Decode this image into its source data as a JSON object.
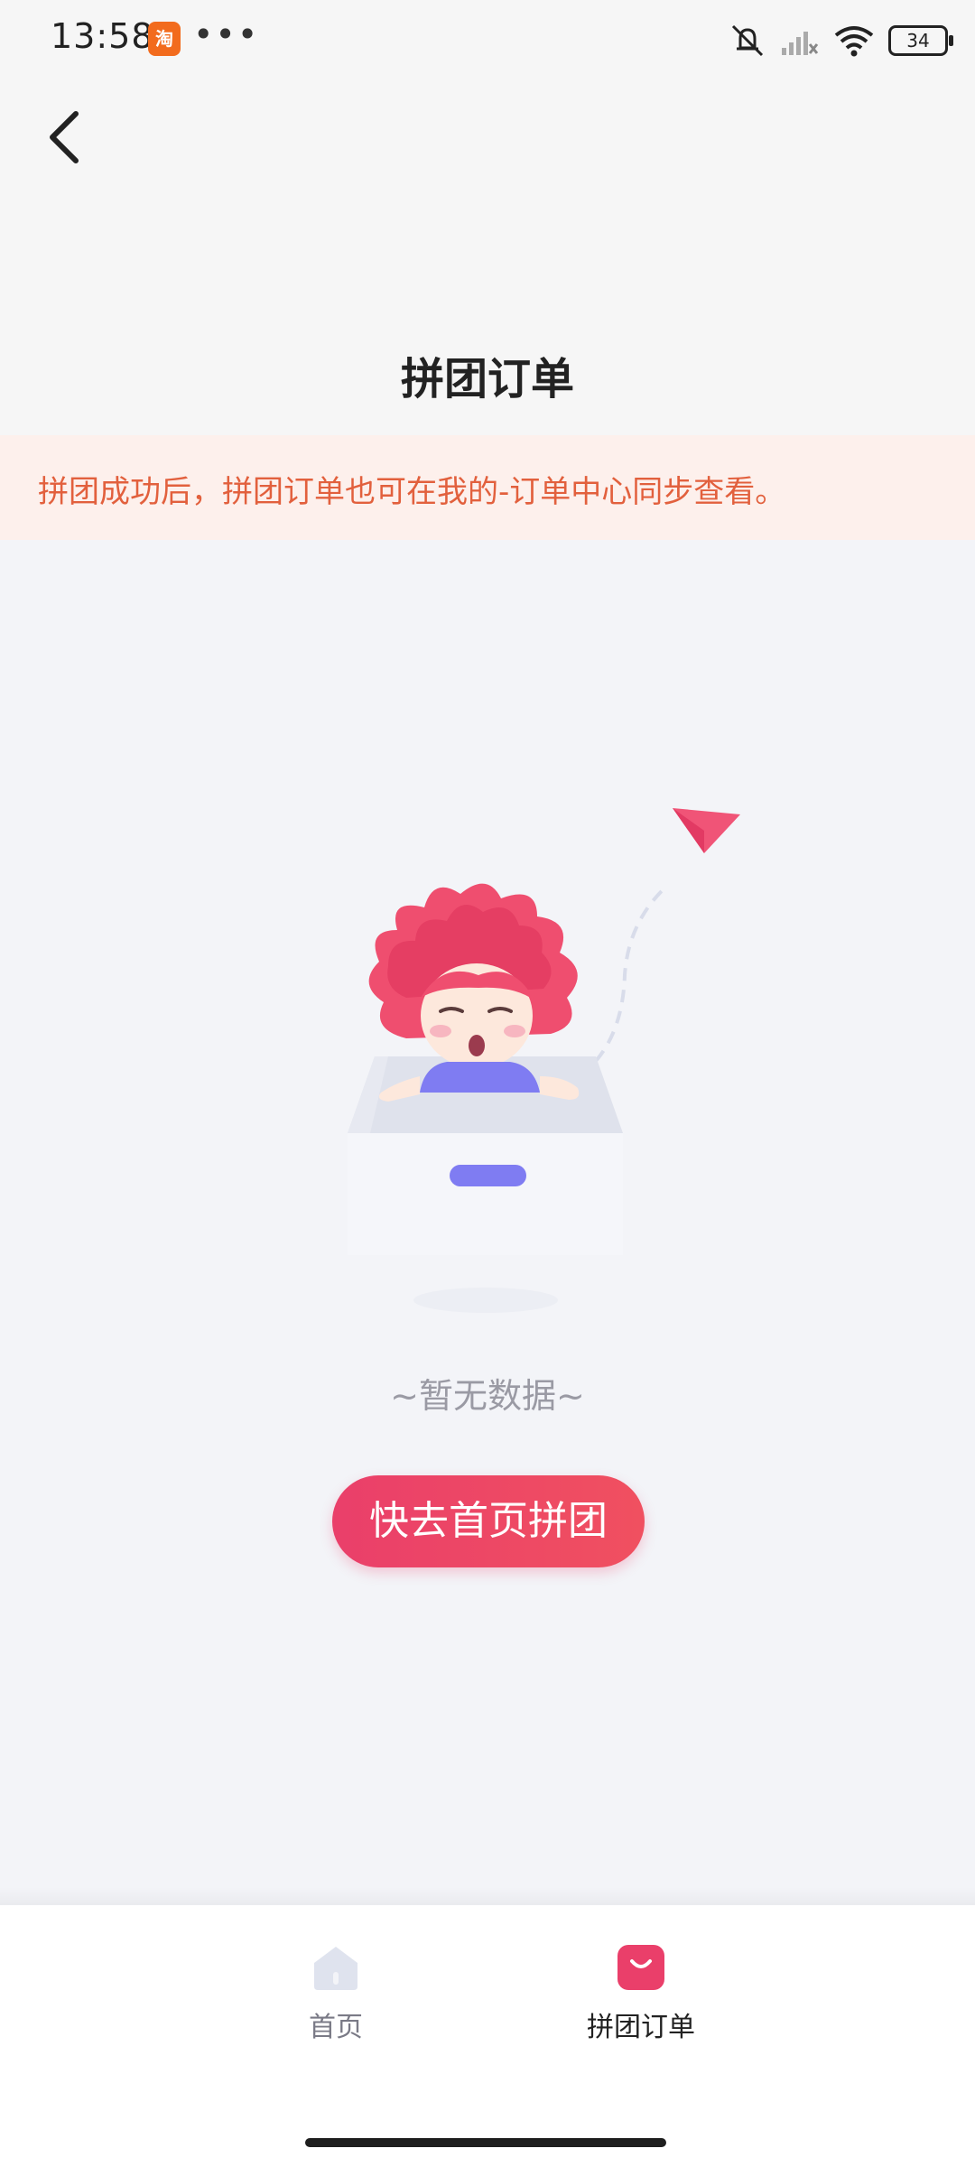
{
  "status_bar": {
    "time": "13:58",
    "app_badge": "淘",
    "more": "•••",
    "battery": "34"
  },
  "header": {
    "title": "拼团订单"
  },
  "notice": {
    "text": "拼团成功后，拼团订单也可在我的-订单中心同步查看。"
  },
  "empty_state": {
    "message": "~暂无数据~",
    "action_label": "快去首页拼团"
  },
  "bottom_nav": {
    "items": [
      {
        "label": "首页",
        "icon": "home-icon",
        "active": false
      },
      {
        "label": "拼团订单",
        "icon": "shopping-bag-icon",
        "active": true
      }
    ]
  },
  "colors": {
    "accent": "#ea3f6a",
    "notice_text": "#e2603d",
    "notice_bg": "#fdf0ec",
    "page_bg": "#f3f4f8"
  }
}
